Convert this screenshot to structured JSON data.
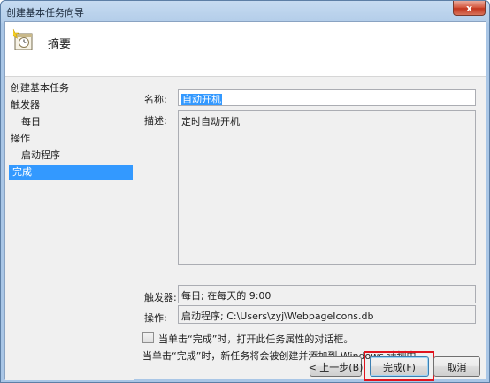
{
  "window": {
    "title": "创建基本任务向导",
    "close_label": "x"
  },
  "header": {
    "title": "摘要",
    "icon": "task-scheduler-clock-icon"
  },
  "nav": {
    "items": [
      {
        "label": "创建基本任务"
      },
      {
        "label": "触发器"
      },
      {
        "label": "每日"
      },
      {
        "label": "操作"
      },
      {
        "label": "启动程序"
      },
      {
        "label": "完成"
      }
    ]
  },
  "form": {
    "name_label": "名称:",
    "name_value": "自动开机",
    "description_label": "描述:",
    "description_value": "定时自动开机",
    "trigger_label": "触发器:",
    "trigger_value": "每日; 在每天的 9:00",
    "action_label": "操作:",
    "action_value": "启动程序; C:\\Users\\zyj\\WebpageIcons.db"
  },
  "options": {
    "open_properties_label": "当单击“完成”时，打开此任务属性的对话框。",
    "info_text": "当单击“完成”时，新任务将会被创建并添加到 Windows 计划中。"
  },
  "buttons": {
    "back_label": "< 上一步(B)",
    "finish_label": "完成(F)",
    "cancel_label": "取消"
  },
  "colors": {
    "selection": "#3399ff",
    "highlight": "#e0141e"
  }
}
